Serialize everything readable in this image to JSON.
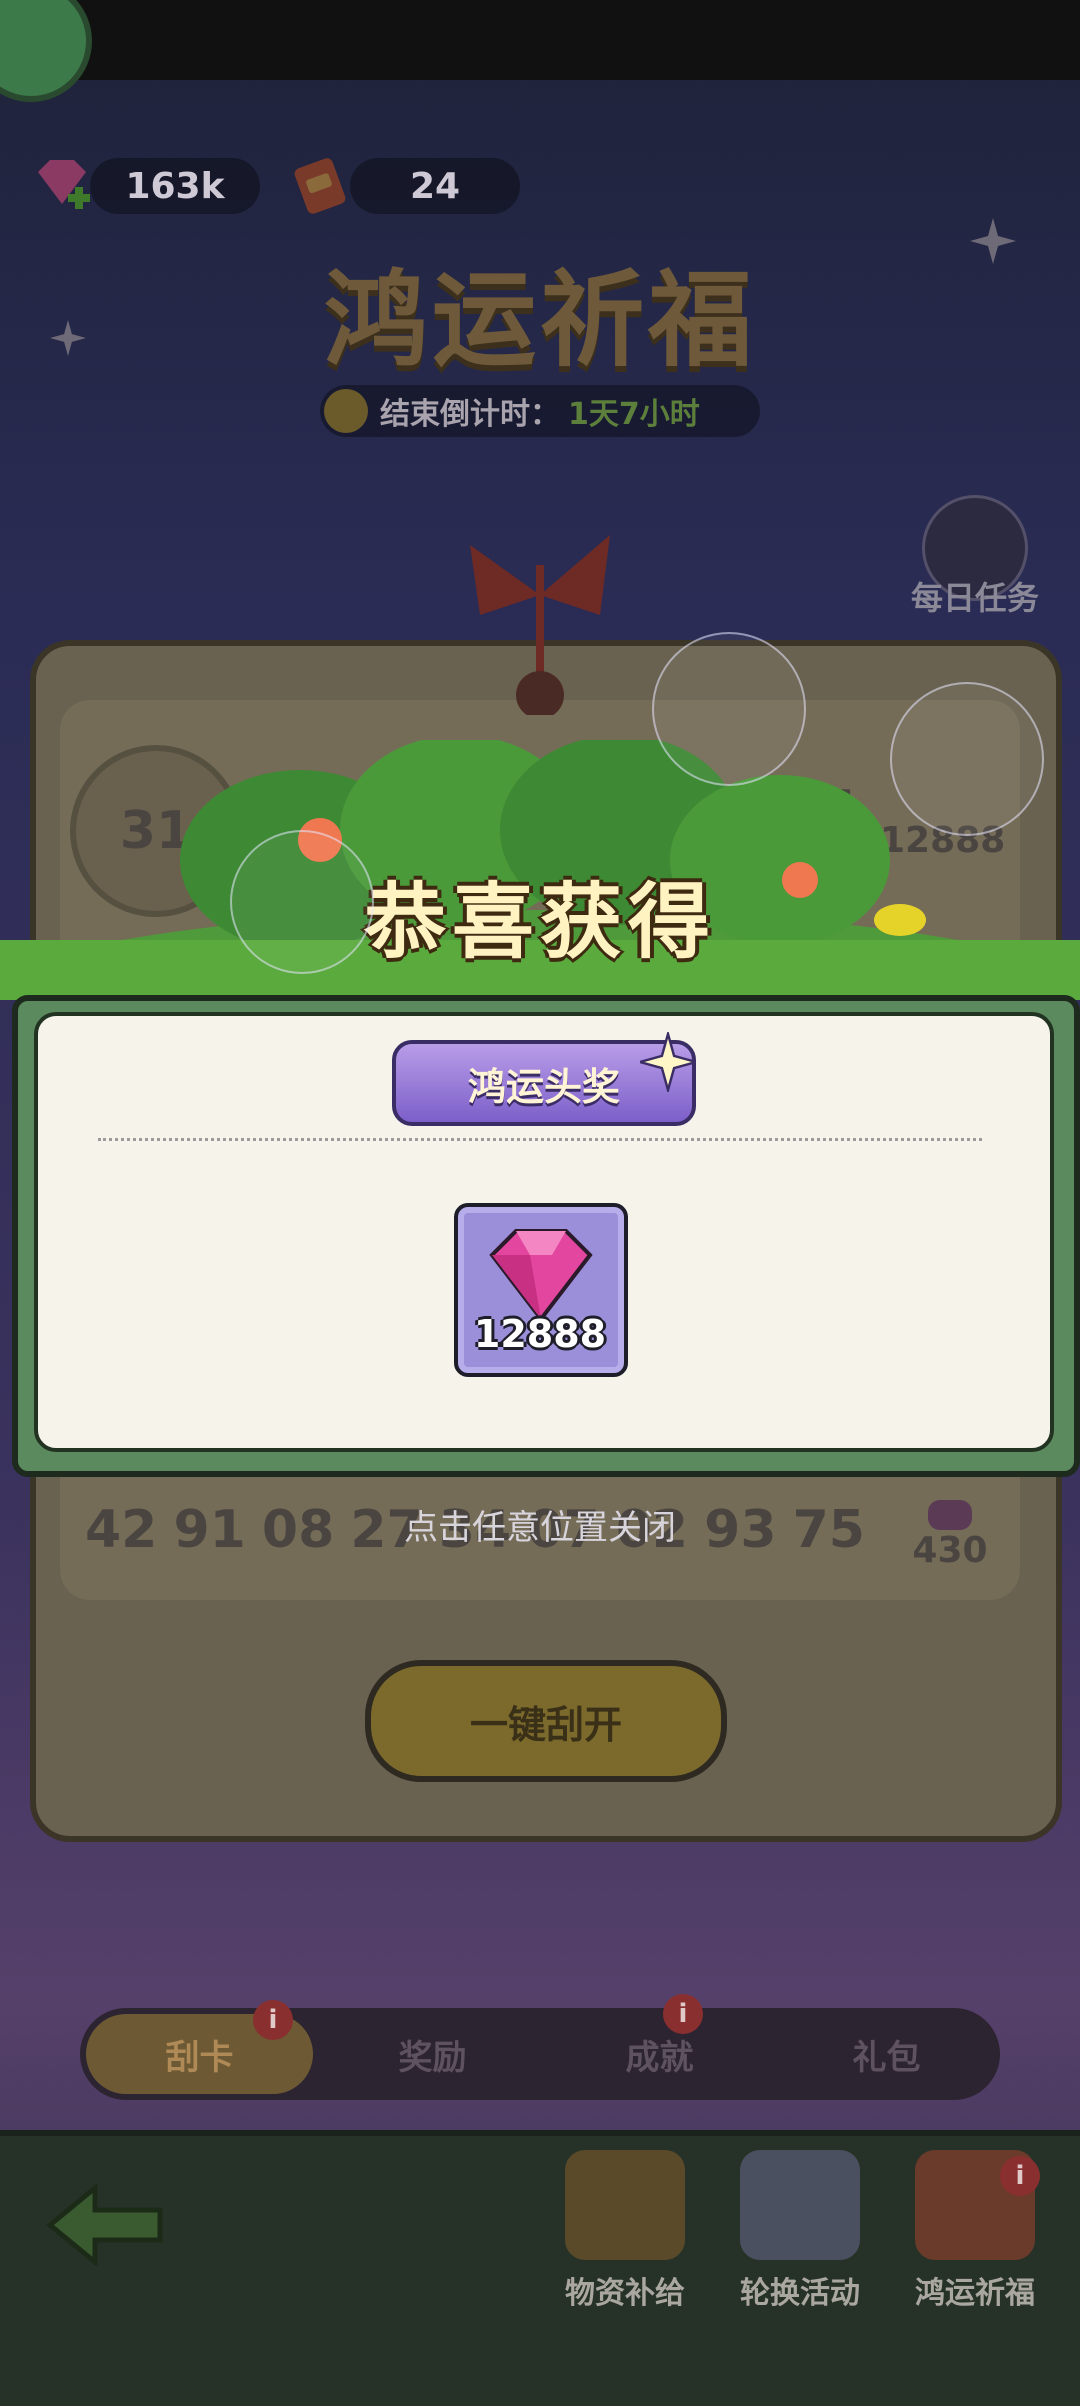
{
  "currencies": {
    "gems": "163k",
    "tickets": "24"
  },
  "header": {
    "title": "鸿运祈福",
    "countdown_label": "结束倒计时：",
    "countdown_value": "1天7小时"
  },
  "daily_tasks": {
    "label": "每日任务"
  },
  "card": {
    "my_number": "31",
    "winning_rows": [
      {
        "number": "31",
        "reward": "12888"
      }
    ],
    "numbers": [
      "42",
      "91",
      "08",
      "27",
      "34",
      "07",
      "02",
      "93",
      "75"
    ],
    "row_reward": "430",
    "scratch_button": "一键刮开"
  },
  "tabs": [
    {
      "label": "刮卡",
      "active": true,
      "badge": "i"
    },
    {
      "label": "奖励",
      "active": false,
      "badge": ""
    },
    {
      "label": "成就",
      "active": false,
      "badge": "i"
    },
    {
      "label": "礼包",
      "active": false,
      "badge": ""
    }
  ],
  "bottom_nav": [
    {
      "label": "物资补给",
      "icon": "supply-chest-icon"
    },
    {
      "label": "轮换活动",
      "icon": "calendar-icon"
    },
    {
      "label": "鸿运祈福",
      "icon": "scratch-card-icon",
      "badge": "i"
    }
  ],
  "modal": {
    "title": "恭喜获得",
    "badge": "鸿运头奖",
    "reward": {
      "icon": "pink-gem-icon",
      "amount": "12888"
    },
    "close_hint": "点击任意位置关闭"
  },
  "colors": {
    "accent_green": "#5b8a5e",
    "badge_purple": "#7c5fc9",
    "gem_pink": "#e2469e"
  }
}
